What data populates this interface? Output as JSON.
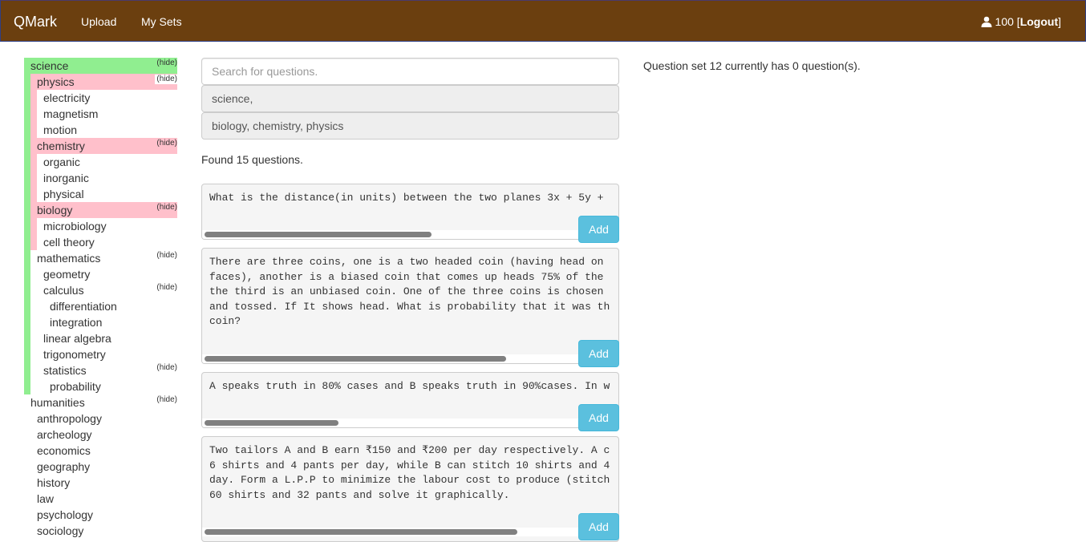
{
  "navbar": {
    "brand": "QMark",
    "links": [
      "Upload",
      "My Sets"
    ],
    "user_icon": "user-icon",
    "user_points": "100",
    "logout_label": "Logout"
  },
  "tree": {
    "hide_label": "(hide)",
    "colors": {
      "root": "#90ee90",
      "branch": "#ffc0cb"
    },
    "items": [
      {
        "label": "science",
        "hide": true
      },
      {
        "label": "physics",
        "hide": true
      },
      {
        "label": "electricity"
      },
      {
        "label": "magnetism"
      },
      {
        "label": "motion"
      },
      {
        "label": "chemistry",
        "hide": true
      },
      {
        "label": "organic"
      },
      {
        "label": "inorganic"
      },
      {
        "label": "physical"
      },
      {
        "label": "biology",
        "hide": true
      },
      {
        "label": "microbiology"
      },
      {
        "label": "cell theory"
      },
      {
        "label": "mathematics",
        "hide": true
      },
      {
        "label": "geometry"
      },
      {
        "label": "calculus",
        "hide": true
      },
      {
        "label": "differentiation"
      },
      {
        "label": "integration"
      },
      {
        "label": "linear algebra"
      },
      {
        "label": "trigonometry"
      },
      {
        "label": "statistics",
        "hide": true
      },
      {
        "label": "probability"
      },
      {
        "label": "humanities",
        "hide": true
      },
      {
        "label": "anthropology"
      },
      {
        "label": "archeology"
      },
      {
        "label": "economics"
      },
      {
        "label": "geography"
      },
      {
        "label": "history"
      },
      {
        "label": "law"
      },
      {
        "label": "psychology"
      },
      {
        "label": "sociology"
      }
    ]
  },
  "search": {
    "placeholder": "Search for questions.",
    "value": "",
    "filters": [
      "science,",
      "biology, chemistry, physics"
    ]
  },
  "results": {
    "found_text": "Found 15 questions.",
    "add_label": "Add",
    "questions": [
      "What is the distance(in units) between the two planes 3x + 5y +",
      "There are three coins, one is a two headed coin (having head on\nfaces), another is a biased coin that comes up heads 75% of the\nthe third is an unbiased coin. One of the three coins is chosen\nand tossed. If It shows head. What is probability that it was th\ncoin?",
      "A speaks truth in 80% cases and B speaks truth in 90%cases. In w",
      "Two tailors A and B earn ₹150 and ₹200 per day respectively. A c\n6 shirts and 4 pants per day, while B can stitch 10 shirts and 4\nday. Form a L.P.P to minimize the labour cost to produce (stitch\n60 shirts and 32 pants and solve it graphically."
    ],
    "scroll_fraction": [
      0.61,
      0.81,
      0.36,
      0.84
    ]
  },
  "question_set": {
    "info": "Question set 12 currently has 0 question(s)."
  }
}
